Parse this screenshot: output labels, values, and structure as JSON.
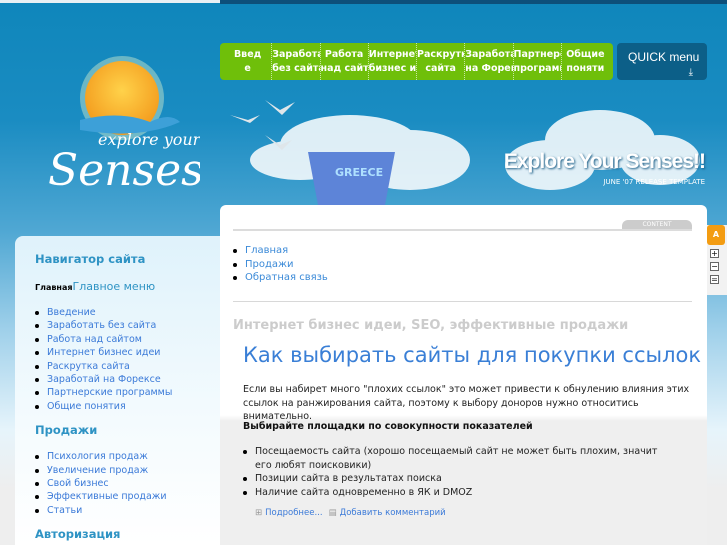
{
  "header": {
    "logo_text": "explore your Senses",
    "tagline": "Explore Your Senses!!",
    "tagline_sub": "JUNE '07 RELEASE TEMPLATE",
    "bowl_text": "GREECE"
  },
  "topmenu": [
    {
      "l1": "Введ",
      "l2": "е"
    },
    {
      "l1": "Заработать",
      "l2": "без сайта"
    },
    {
      "l1": "Работа",
      "l2": "над сайто"
    },
    {
      "l1": "Интернет",
      "l2": "бизнес иде"
    },
    {
      "l1": "Раскрутк",
      "l2": "сайта"
    },
    {
      "l1": "Заработай",
      "l2": "на Форекс"
    },
    {
      "l1": "Партнерски",
      "l2": "программы"
    },
    {
      "l1": "Общие",
      "l2": "поняти"
    }
  ],
  "quick_menu": {
    "label": "QUICK menu",
    "icon": "arrow-down-icon"
  },
  "sidebar": {
    "nav_title": "Навигатор сайта",
    "main_small": "Главная",
    "main_title": "Главное меню",
    "main_items": [
      "Введение",
      "Заработать без сайта",
      "Работа над сайтом",
      "Интернет бизнес идеи",
      "Раскрутка сайта",
      "Заработай на Форексе",
      "Партнерские программы",
      "Общие понятия"
    ],
    "sales_title": "Продажи",
    "sales_items": [
      "Психология продаж",
      "Увеличение продаж",
      "Свой бизнес",
      "Эффективные продажи",
      "Статьи"
    ],
    "auth_title": "Авторизация"
  },
  "content": {
    "tab": "CONTENT",
    "crumbs": [
      "Главная",
      "Продажи",
      "Обратная связь"
    ],
    "site_title": "Интернет бизнес идеи, SEO, эффективные продажи",
    "article_title": "Как выбирать сайты для покупки ссылок",
    "paragraph": "Если вы набирет много \"плохих ссылок\"   это может  привести к обнулению влияния этих ссылок на ранжирования сайта, поэтому к выбору доноров нужно относитись внимательно.",
    "subheading": "Выбирайте площадки по совокупности показателей",
    "points": [
      "Посещаемость сайта (хорошо посещаемый сайт не может быть плохим, значит его любят поисковики)",
      "Позиции сайта в результатах поиска",
      "Наличие сайта одновременно в ЯК и DMOZ"
    ],
    "more": "Подробнее...",
    "comment": "Добавить комментарий"
  },
  "widget": {
    "a": "A",
    "plus": "+",
    "minus": "−",
    "reset": "="
  },
  "colors": {
    "menu_green": "#6fbf0a",
    "quick_blue": "#0c5f88",
    "link": "#3b7ad8",
    "heading": "#2e93c4"
  }
}
